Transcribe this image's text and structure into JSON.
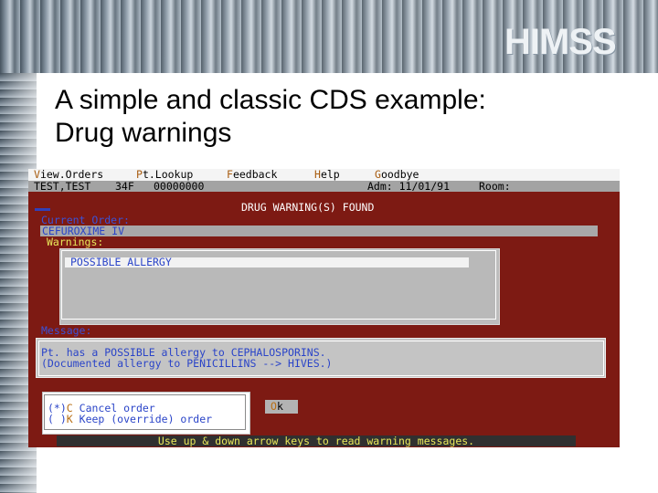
{
  "logo": {
    "text": "HIMSS"
  },
  "slide": {
    "title_line1": "A simple and classic CDS example:",
    "title_line2": "Drug warnings"
  },
  "colors": {
    "terminal_bg": "#7d1a13",
    "menu_hotkey": "#a85c10",
    "label_yellow": "#e8e85a",
    "text_blue": "#2a44c8"
  },
  "menu": {
    "items": [
      {
        "hotkey": "V",
        "rest": "iew.Orders"
      },
      {
        "hotkey": "P",
        "rest": "t.Lookup"
      },
      {
        "hotkey": "F",
        "rest": "eedback"
      },
      {
        "hotkey": "H",
        "rest": "elp"
      },
      {
        "hotkey": "G",
        "rest": "oodbye"
      }
    ]
  },
  "patient": {
    "name": "TEST,TEST",
    "age_sex": "34F",
    "id": "00000000",
    "admit": "Adm: 11/01/91",
    "room": "Room:"
  },
  "banner": "DRUG WARNING(S) FOUND",
  "current_order": {
    "label": "Current Order:",
    "value": "CEFUROXIME   IV"
  },
  "warnings": {
    "label": "Warnings:",
    "items": [
      "POSSIBLE ALLERGY"
    ]
  },
  "message": {
    "label": "Message:",
    "line1": "Pt. has a POSSIBLE allergy to CEPHALOSPORINS.",
    "line2": "(Documented allergy to PENICILLINS --> HIVES.)"
  },
  "options": [
    {
      "prefix": "(*)",
      "hotkey": "C",
      "label": " Cancel order"
    },
    {
      "prefix": "( )",
      "hotkey": "K",
      "label": " Keep (override) order"
    }
  ],
  "ok_button": {
    "hotkey": "O",
    "rest": "k"
  },
  "status": "Use up & down arrow keys to read warning messages."
}
